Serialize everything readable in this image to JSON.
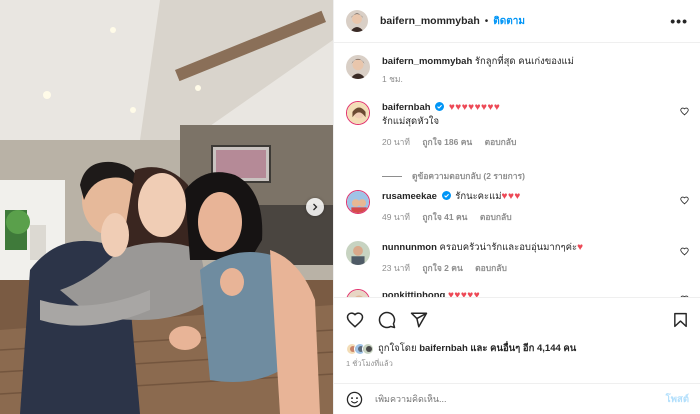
{
  "header": {
    "username": "baifern_mommybah",
    "separator": "•",
    "follow_label": "ติดตาม",
    "more_label": "•••"
  },
  "caption": {
    "username": "baifern_mommybah",
    "text": "รักลูกที่สุด คนเก่งของแม่",
    "time": "1 ชม."
  },
  "comments": [
    {
      "username": "baifernbah",
      "verified": true,
      "text_line1": "♥♥♥♥♥♥♥♥",
      "text_line2": "รักแม่สุดหัวใจ",
      "time": "20 นาที",
      "likes": "ถูกใจ 186 คน",
      "reply": "ตอบกลับ",
      "view_replies": "ดูข้อความตอบกลับ (2 รายการ)"
    },
    {
      "username": "rusameekae",
      "verified": true,
      "text": "รักนะคะแม่",
      "hearts": "♥♥♥",
      "time": "49 นาที",
      "likes": "ถูกใจ 41 คน",
      "reply": "ตอบกลับ"
    },
    {
      "username": "nunnunmon",
      "text": "ครอบครัวน่ารักและอบอุ่นมากๆค่ะ",
      "hearts": "♥",
      "time": "23 นาที",
      "likes": "ถูกใจ 2 คน",
      "reply": "ตอบกลับ"
    },
    {
      "username": "ponkittiphong",
      "hearts": "♥♥♥♥♥"
    }
  ],
  "likes": {
    "prefix": "ถูกใจโดย",
    "user": "baifernbah",
    "middle": "และ",
    "others": "คนอื่นๆ อีก 4,144 คน"
  },
  "posted": "1 ชั่วโมงที่แล้ว",
  "composer": {
    "placeholder": "เพิ่มความคิดเห็น...",
    "post_label": "โพสต์"
  },
  "colors": {
    "link": "#0095f6",
    "heart": "#ed4956",
    "muted": "#8e8e8e",
    "post_disabled": "#b2dffc"
  },
  "icons": [
    "heart-icon",
    "comment-icon",
    "share-icon",
    "bookmark-icon",
    "verified-icon",
    "emoji-icon",
    "chevron-right-icon",
    "more-icon"
  ]
}
